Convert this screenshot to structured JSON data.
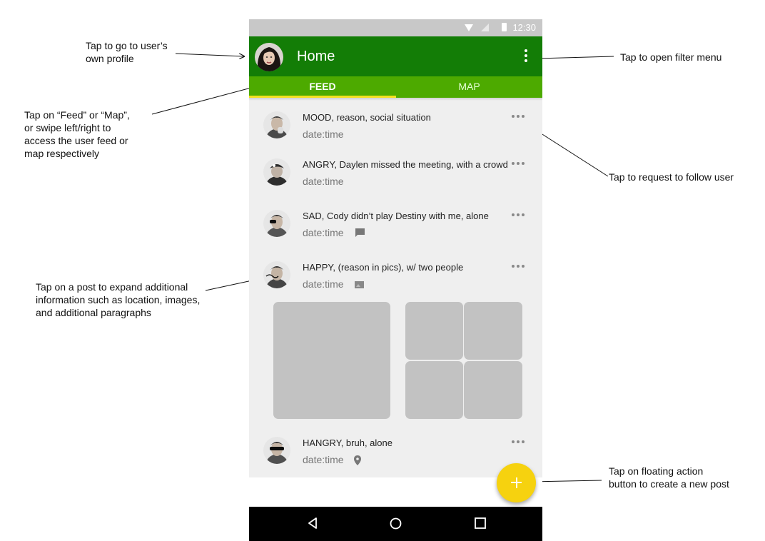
{
  "annotations": {
    "profile": "Tap to go to user’s\nown profile",
    "filter": "Tap to open filter menu",
    "tabs": "Tap on “Feed” or “Map”,\nor swipe left/right to\naccess the user feed or\nmap respectively",
    "follow": "Tap to request to follow user",
    "expand": "Tap on a post to expand additional\ninformation such as location, images,\nand additional paragraphs",
    "fab": "Tap on floating action\nbutton to create a new post"
  },
  "status_bar": {
    "time": "12:30"
  },
  "app_bar": {
    "title": "Home"
  },
  "tabs": [
    {
      "label": "FEED",
      "selected": true
    },
    {
      "label": "MAP",
      "selected": false
    }
  ],
  "posts": [
    {
      "headline": "MOOD, reason, social situation",
      "date": "date:time",
      "attachment": "none"
    },
    {
      "headline": "ANGRY, Daylen missed the meeting, with a crowd",
      "date": "date:time",
      "attachment": "none"
    },
    {
      "headline": "SAD, Cody didn’t play Destiny with me, alone",
      "date": "date:time",
      "attachment": "comment-icon"
    },
    {
      "headline": "HAPPY, (reason in pics), w/ two people",
      "date": "date:time",
      "attachment": "image-icon"
    },
    {
      "headline": "HANGRY, bruh, alone",
      "date": "date:time",
      "attachment": "location-pin-icon"
    }
  ],
  "colors": {
    "app_bar": "#137d06",
    "tab_bar": "#4daa00",
    "tab_indicator": "#f4e11e",
    "fab": "#f6d20f",
    "image_placeholder": "#c2c2c2"
  }
}
